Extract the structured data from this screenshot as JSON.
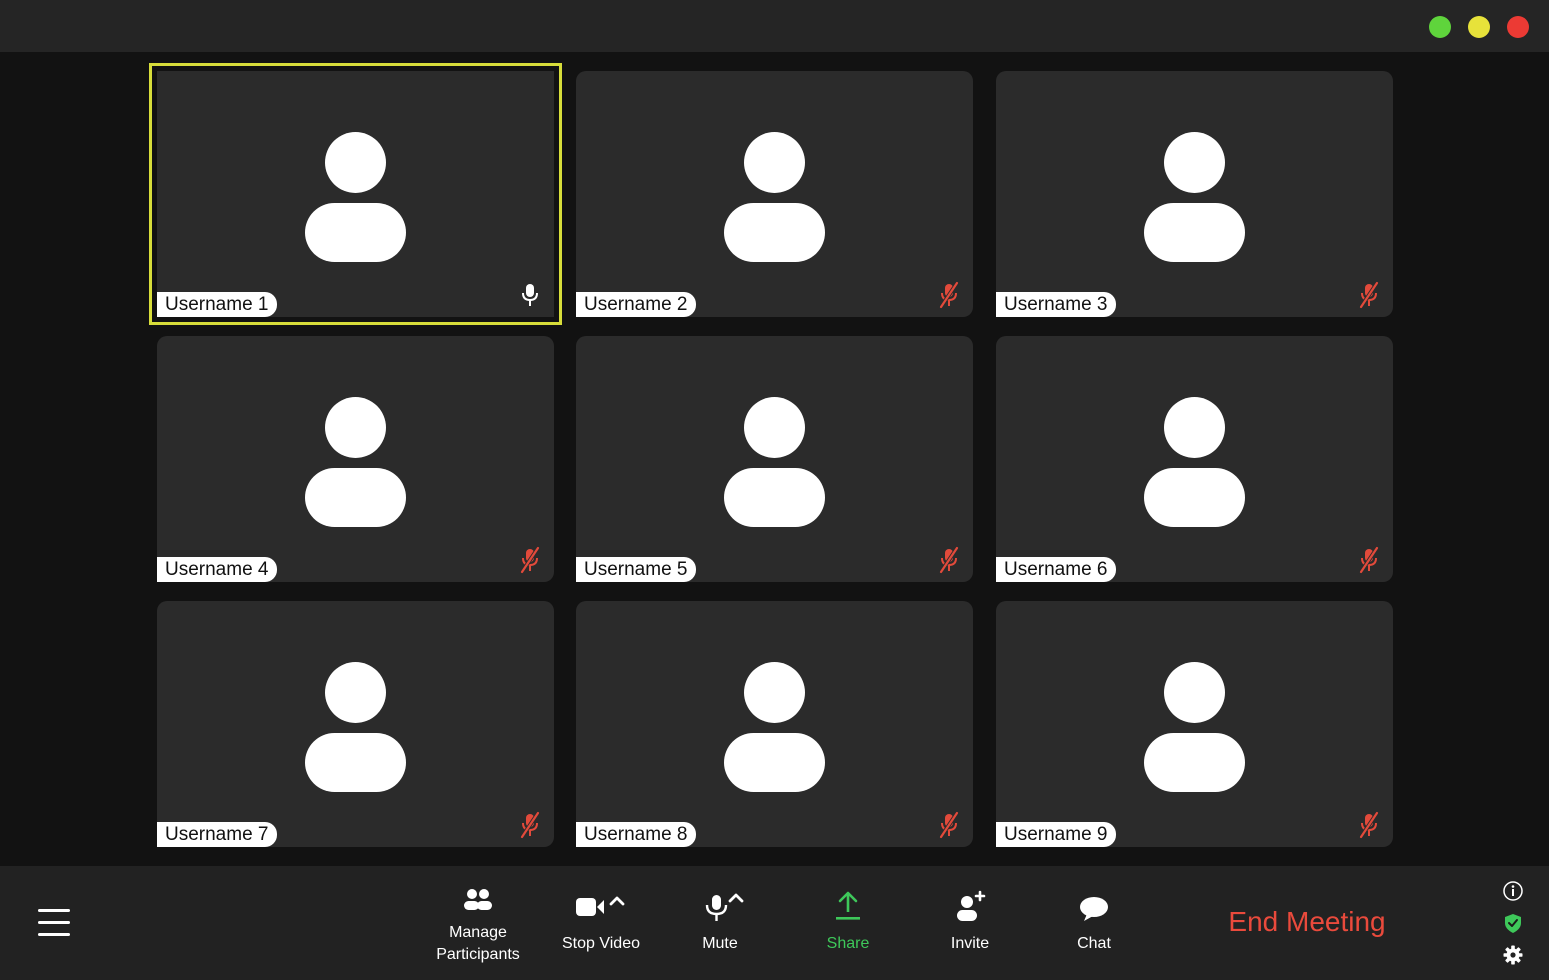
{
  "window": {
    "controls": [
      {
        "name": "maximize",
        "color": "#5fd43c"
      },
      {
        "name": "minimize",
        "color": "#e7e23a"
      },
      {
        "name": "close",
        "color": "#ec3a34"
      }
    ]
  },
  "participants": [
    {
      "name": "Username 1",
      "mic": "on",
      "active": true
    },
    {
      "name": "Username 2",
      "mic": "muted",
      "active": false
    },
    {
      "name": "Username 3",
      "mic": "muted",
      "active": false
    },
    {
      "name": "Username 4",
      "mic": "muted",
      "active": false
    },
    {
      "name": "Username 5",
      "mic": "muted",
      "active": false
    },
    {
      "name": "Username 6",
      "mic": "muted",
      "active": false
    },
    {
      "name": "Username 7",
      "mic": "muted",
      "active": false
    },
    {
      "name": "Username 8",
      "mic": "muted",
      "active": false
    },
    {
      "name": "Username 9",
      "mic": "muted",
      "active": false
    }
  ],
  "toolbar": {
    "manage_participants_line1": "Manage",
    "manage_participants_line2": "Participants",
    "stop_video": "Stop Video",
    "mute": "Mute",
    "share": "Share",
    "invite": "Invite",
    "chat": "Chat",
    "end_meeting": "End Meeting"
  },
  "colors": {
    "active_speaker_border": "#d7dd3a",
    "muted_mic": "#e24a3b",
    "share_accent": "#3ec85a",
    "end_meeting": "#ea4a3c",
    "security_shield": "#3ec85a"
  },
  "icons": {
    "menu": "hamburger-menu-icon",
    "participants": "participants-icon",
    "video": "video-camera-icon",
    "mic": "microphone-icon",
    "share": "share-upload-icon",
    "invite": "add-person-icon",
    "chat": "chat-bubble-icon",
    "info": "info-icon",
    "security": "shield-icon",
    "settings": "gear-icon"
  }
}
